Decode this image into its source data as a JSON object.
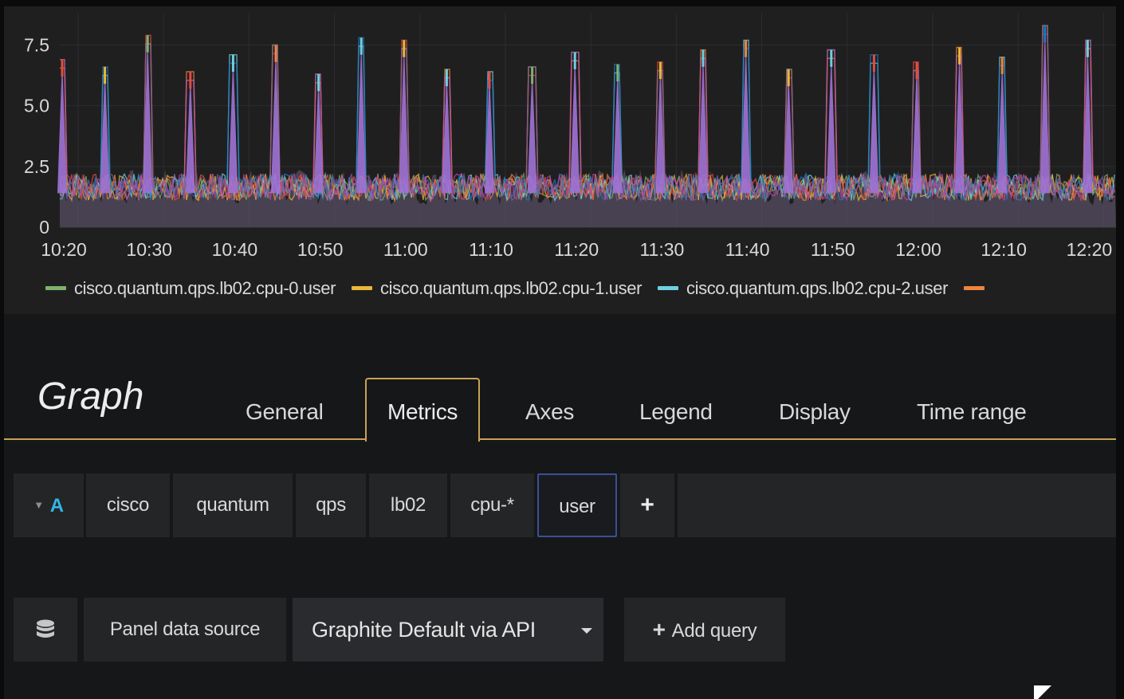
{
  "graph": {
    "y_ticks": [
      "7.5",
      "5.0",
      "2.5",
      "0"
    ],
    "x_ticks": [
      "10:20",
      "10:30",
      "10:40",
      "10:50",
      "11:00",
      "11:10",
      "11:20",
      "11:30",
      "11:40",
      "11:50",
      "12:00",
      "12:10",
      "12:20"
    ],
    "legend": [
      {
        "label": "cisco.quantum.qps.lb02.cpu-0.user",
        "color": "#7eb26d"
      },
      {
        "label": "cisco.quantum.qps.lb02.cpu-1.user",
        "color": "#eab839"
      },
      {
        "label": "cisco.quantum.qps.lb02.cpu-2.user",
        "color": "#6ed0e0"
      },
      {
        "label": "",
        "color": "#ef843c"
      }
    ]
  },
  "editor": {
    "panel_type": "Graph",
    "tabs": [
      "General",
      "Metrics",
      "Axes",
      "Legend",
      "Display",
      "Time range"
    ],
    "active_tab": "Metrics"
  },
  "query": {
    "ref_id": "A",
    "segments": [
      "cisco",
      "quantum",
      "qps",
      "lb02",
      "cpu-*",
      "user"
    ],
    "add_label": "+"
  },
  "datasource": {
    "panel_label": "Panel data source",
    "selected": "Graphite Default via API",
    "add_query_label": "Add query"
  },
  "chart_data": {
    "type": "line",
    "title": "",
    "xlabel": "",
    "ylabel": "",
    "ylim": [
      0,
      8.5
    ],
    "y_ticks": [
      0,
      2.5,
      5.0,
      7.5
    ],
    "x_ticks": [
      "10:20",
      "10:30",
      "10:40",
      "10:50",
      "11:00",
      "11:10",
      "11:20",
      "11:30",
      "11:40",
      "11:50",
      "12:00",
      "12:10",
      "12:20"
    ],
    "baseline_range": [
      0.9,
      2.4
    ],
    "spikes": [
      {
        "x": "10:20",
        "y": 6.9,
        "color": "#e24d42"
      },
      {
        "x": "10:25",
        "y": 6.6,
        "color": "#eab839"
      },
      {
        "x": "10:30",
        "y": 7.9,
        "color": "#7eb26d"
      },
      {
        "x": "10:35",
        "y": 6.4,
        "color": "#e24d42"
      },
      {
        "x": "10:40",
        "y": 7.1,
        "color": "#6ed0e0"
      },
      {
        "x": "10:45",
        "y": 7.5,
        "color": "#ef843c"
      },
      {
        "x": "10:50",
        "y": 6.3,
        "color": "#6ed0e0"
      },
      {
        "x": "10:55",
        "y": 7.8,
        "color": "#6ed0e0"
      },
      {
        "x": "11:00",
        "y": 7.7,
        "color": "#eab839"
      },
      {
        "x": "11:05",
        "y": 6.5,
        "color": "#6ed0e0"
      },
      {
        "x": "11:10",
        "y": 6.4,
        "color": "#e24d42"
      },
      {
        "x": "11:15",
        "y": 6.6,
        "color": "#7eb26d"
      },
      {
        "x": "11:20",
        "y": 7.2,
        "color": "#6ed0e0"
      },
      {
        "x": "11:25",
        "y": 6.7,
        "color": "#7eb26d"
      },
      {
        "x": "11:30",
        "y": 6.8,
        "color": "#eab839"
      },
      {
        "x": "11:35",
        "y": 7.3,
        "color": "#6ed0e0"
      },
      {
        "x": "11:40",
        "y": 7.7,
        "color": "#ef843c"
      },
      {
        "x": "11:45",
        "y": 6.5,
        "color": "#eab839"
      },
      {
        "x": "11:50",
        "y": 7.3,
        "color": "#6ed0e0"
      },
      {
        "x": "11:55",
        "y": 7.1,
        "color": "#e24d42"
      },
      {
        "x": "12:00",
        "y": 6.8,
        "color": "#e24d42"
      },
      {
        "x": "12:05",
        "y": 7.4,
        "color": "#eab839"
      },
      {
        "x": "12:10",
        "y": 7.0,
        "color": "#ef843c"
      },
      {
        "x": "12:15",
        "y": 8.3,
        "color": "#1f78c1"
      },
      {
        "x": "12:20",
        "y": 7.7,
        "color": "#6ed0e0"
      }
    ]
  }
}
